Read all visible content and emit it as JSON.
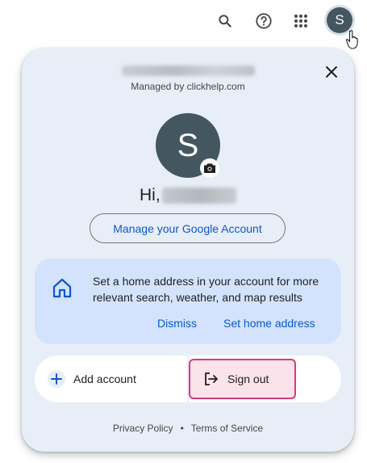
{
  "topbar": {
    "search_icon": "search-icon",
    "help_icon": "help-icon",
    "apps_icon": "apps-grid-icon",
    "avatar_initial": "S"
  },
  "panel": {
    "managed_by": "Managed by clickhelp.com",
    "avatar_initial": "S",
    "greeting": "Hi,",
    "manage_button": "Manage your Google Account",
    "home_card": {
      "text": "Set a home address in your account for more relevant search, weather, and map results",
      "dismiss": "Dismiss",
      "set_home": "Set home address"
    },
    "add_account": "Add account",
    "sign_out": "Sign out",
    "footer": {
      "privacy": "Privacy Policy",
      "separator": "•",
      "terms": "Terms of Service"
    }
  },
  "colors": {
    "panel_bg": "#e8eef8",
    "card_bg": "#d3e3fd",
    "link": "#0b57d0",
    "avatar": "#44565f",
    "signout_border": "#d93a7a",
    "signout_bg": "#fbe3ec"
  }
}
